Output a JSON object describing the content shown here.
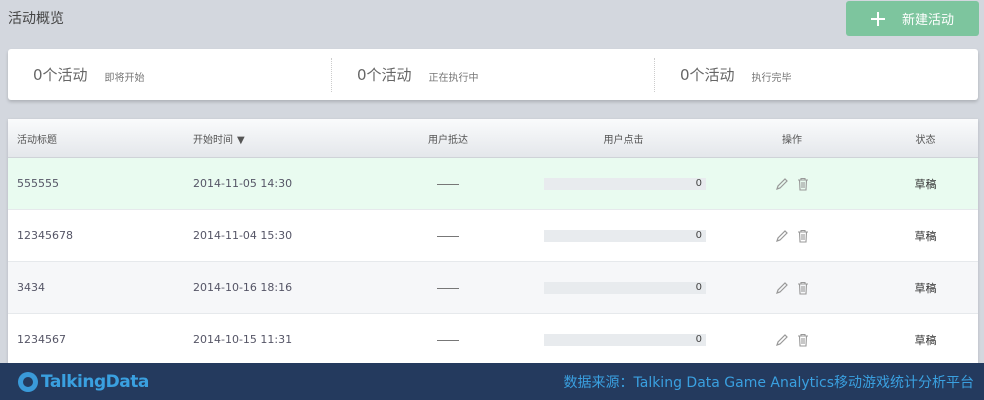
{
  "page": {
    "title": "活动概览"
  },
  "toolbar": {
    "new_label": "新建活动"
  },
  "summary": [
    {
      "count": "0个活动",
      "label": "即将开始"
    },
    {
      "count": "0个活动",
      "label": "正在执行中"
    },
    {
      "count": "0个活动",
      "label": "执行完毕"
    }
  ],
  "table": {
    "headers": {
      "title": "活动标题",
      "start_time": "开始时间",
      "sort_arrow": "▼",
      "reach": "用户抵达",
      "clicks": "用户点击",
      "ops": "操作",
      "status": "状态"
    },
    "rows": [
      {
        "title": "555555",
        "start_time": "2014-11-05 14:30",
        "clicks": "0",
        "click_fraction": 0,
        "status": "草稿"
      },
      {
        "title": "12345678",
        "start_time": "2014-11-04 15:30",
        "clicks": "0",
        "click_fraction": 0,
        "status": "草稿"
      },
      {
        "title": "3434",
        "start_time": "2014-10-16 18:16",
        "clicks": "0",
        "click_fraction": 0,
        "status": "草稿"
      },
      {
        "title": "1234567",
        "start_time": "2014-10-15 11:31",
        "clicks": "0",
        "click_fraction": 0,
        "status": "草稿"
      }
    ]
  },
  "icons": {
    "new": "plus-icon",
    "edit": "pencil-icon",
    "delete": "trash-icon",
    "logo": "talkingdata-logo-icon"
  },
  "footer": {
    "logo_text": "TalkingData",
    "source": "数据来源：Talking Data Game Analytics移动游戏统计分析平台"
  },
  "colors": {
    "accent": "#7dc59e",
    "footer_bg": "#243a5e",
    "footer_text": "#3aa0e0",
    "highlight_row": "#e9fbf0"
  }
}
